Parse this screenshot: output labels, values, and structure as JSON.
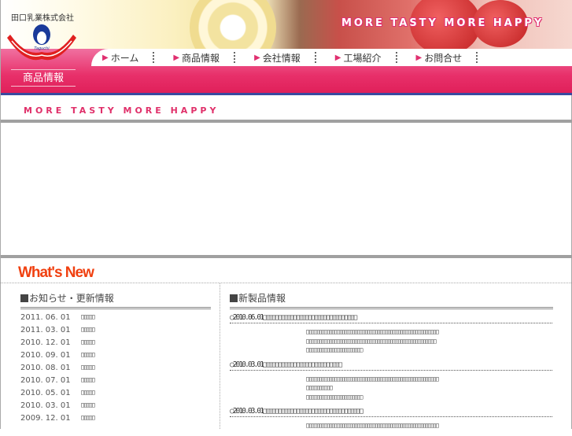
{
  "header": {
    "company": "田口乳業株式会社",
    "slogan": "MORE TASTY MORE HAPPY",
    "logo_text": "Taguchi",
    "section": "商品情報"
  },
  "nav": [
    {
      "label": "ホーム"
    },
    {
      "label": "商品情報"
    },
    {
      "label": "会社情報"
    },
    {
      "label": "工場紹介"
    },
    {
      "label": "お問合せ"
    }
  ],
  "banner_slogan": "MORE TASTY MORE HAPPY",
  "whats_new": "What's New",
  "news": {
    "heading": "お知らせ・更新情報",
    "items": [
      {
        "date": "2011. 06. 01",
        "title": "□□□□□"
      },
      {
        "date": "2011. 03. 01",
        "title": "□□□□□"
      },
      {
        "date": "2010. 12. 01",
        "title": "□□□□□"
      },
      {
        "date": "2010. 09. 01",
        "title": "□□□□□"
      },
      {
        "date": "2010. 08. 01",
        "title": "□□□□□"
      },
      {
        "date": "2010. 07. 01",
        "title": "□□□□□"
      },
      {
        "date": "2010. 05. 01",
        "title": "□□□□□"
      },
      {
        "date": "2010. 03. 01",
        "title": "□□□□□"
      },
      {
        "date": "2009. 12. 01",
        "title": "□□□□□"
      }
    ]
  },
  "products": {
    "heading": "新製品情報",
    "entries": [
      {
        "title": "○2010.06.01□□□□□□□□□□□□□□□□□□□□□□□□□□□□□□□",
        "body": [
          "□□□□□□□□□□□□□□□□□□□□□□□□□□□□□□□□□□□□□□□□□□□□□□□□□□□□",
          "□□□□□□□□□□□□□□□□□□□□□□□□□□□□□□□□□□□□□□□□□□□□□□□□□□□",
          "□□□□□□□□□□□□□□□□□□□□□□"
        ]
      },
      {
        "title": "○2010.03.01□□□□□□□□□□□□□□□□□□□□□□□□□□",
        "body": [
          "□□□□□□□□□□□□□□□□□□□□□□□□□□□□□□□□□□□□□□□□□□□□□□□□□□□□",
          "□□□□□□□□□□",
          "□□□□□□□□□□□□□□□□□□□□□□"
        ]
      },
      {
        "title": "○2010.03.01□□□□□□□□□□□□□□□□□□□□□□□□□□□□□□□□□",
        "body": [
          "□□□□□□□□□□□□□□□□□□□□□□□□□□□□□□□□□□□□□□□□□□□□□□□□□□□□"
        ]
      }
    ]
  },
  "colors": {
    "pink": "#e8306a",
    "blue_line": "#3a4aa0",
    "whats_new": "#f04010"
  }
}
